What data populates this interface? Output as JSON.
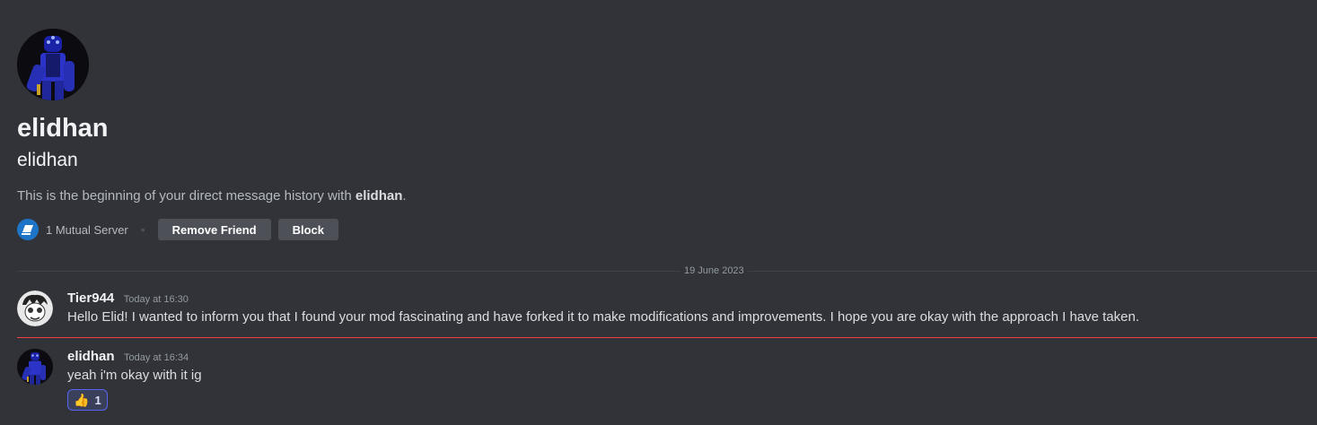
{
  "profile": {
    "display_name": "elidhan",
    "username": "elidhan",
    "intro_prefix": "This is the beginning of your direct message history with ",
    "intro_name": "elidhan",
    "intro_suffix": ".",
    "mutual_servers": "1 Mutual Server",
    "remove_friend_label": "Remove Friend",
    "block_label": "Block"
  },
  "date_divider": "19 June 2023",
  "messages": [
    {
      "author": "Tier944",
      "timestamp": "Today at 16:30",
      "text": "Hello Elid! I wanted to inform you that I found your mod fascinating and have forked it to make modifications and improvements. I hope you are okay with the approach I have taken."
    },
    {
      "author": "elidhan",
      "timestamp": "Today at 16:34",
      "text": "yeah i'm okay with it ig",
      "reaction": {
        "emoji": "👍",
        "count": "1"
      }
    }
  ],
  "colors": {
    "background": "#313338",
    "new_message_line": "#f23f43",
    "reaction_border": "#5865f2",
    "button": "#4e5058"
  }
}
